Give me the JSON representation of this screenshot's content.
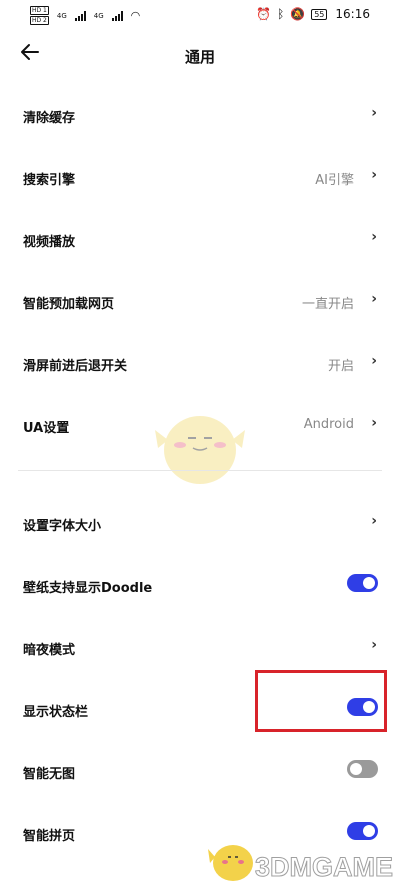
{
  "statusbar": {
    "sim1": "HD 1",
    "sim2": "HD 2",
    "net1": "4G",
    "net2": "4G",
    "battery": "55",
    "time": "16:16"
  },
  "header": {
    "title": "通用",
    "back_icon": "arrow-left-icon"
  },
  "settings": [
    {
      "label": "清除缓存",
      "value": "",
      "control": "chevron"
    },
    {
      "label": "搜索引擎",
      "value": "AI引擎",
      "control": "chevron"
    },
    {
      "label": "视频播放",
      "value": "",
      "control": "chevron"
    },
    {
      "label": "智能预加载网页",
      "value": "一直开启",
      "control": "chevron"
    },
    {
      "label": "滑屏前进后退开关",
      "value": "开启",
      "control": "chevron"
    },
    {
      "label": "UA设置",
      "value": "Android",
      "control": "chevron"
    },
    {
      "label": "设置字体大小",
      "value": "",
      "control": "chevron"
    },
    {
      "label": "壁纸支持显示Doodle",
      "value": "",
      "control": "toggle",
      "on": true
    },
    {
      "label": "暗夜模式",
      "value": "",
      "control": "chevron"
    },
    {
      "label": "显示状态栏",
      "value": "",
      "control": "toggle",
      "on": true
    },
    {
      "label": "智能无图",
      "value": "",
      "control": "toggle",
      "on": false
    },
    {
      "label": "智能拼页",
      "value": "",
      "control": "toggle",
      "on": true
    }
  ],
  "chevron_glyph": "›",
  "colors": {
    "toggle_on": "#2f3ee6",
    "toggle_off": "#9a9a9a",
    "highlight_box": "#d8232a"
  },
  "watermark": {
    "text": "3DMGAME"
  }
}
